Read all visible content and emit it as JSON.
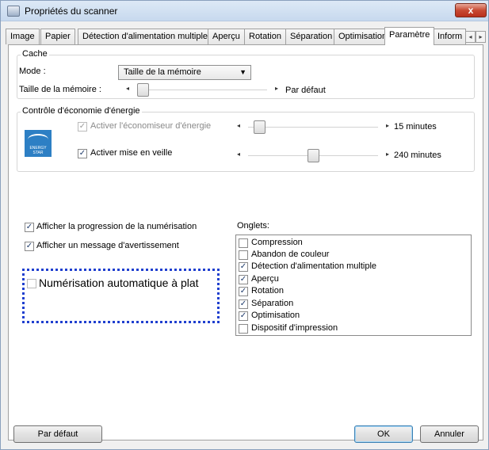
{
  "window": {
    "title": "Propriétés du scanner",
    "close_glyph": "x"
  },
  "tabs": [
    "Image",
    "Papier",
    "Détection d'alimentation multiple",
    "Aperçu",
    "Rotation",
    "Séparation",
    "Optimisation",
    "Paramètre",
    "Inform"
  ],
  "active_tab": "Paramètre",
  "tab_scroll": {
    "left": "◂",
    "right": "▸"
  },
  "cache": {
    "title": "Cache",
    "mode_label": "Mode :",
    "mode_value": "Taille de la mémoire",
    "size_label": "Taille de la mémoire :",
    "size_value": "Par défaut",
    "size_level": 0.0
  },
  "energy": {
    "title": "Contrôle d'économie d'énergie",
    "logo_text": "ENERGY STAR",
    "logo_script": "energy",
    "saver_label": "Activer l'économiseur d'énergie",
    "saver_checked": true,
    "saver_enabled": false,
    "saver_value": "15 minutes",
    "saver_level": 0.05,
    "sleep_label": "Activer mise en veille",
    "sleep_checked": true,
    "sleep_value": "240 minutes",
    "sleep_level": 0.5
  },
  "options": {
    "show_progress": "Afficher la progression de la numérisation",
    "show_warning": "Afficher un message d'avertissement",
    "auto_flatbed": "Numérisation automatique à plat"
  },
  "onglets": {
    "label": "Onglets:",
    "items": [
      {
        "label": "Compression",
        "checked": false
      },
      {
        "label": "Abandon de couleur",
        "checked": false
      },
      {
        "label": "Détection d'alimentation multiple",
        "checked": true
      },
      {
        "label": "Aperçu",
        "checked": true
      },
      {
        "label": "Rotation",
        "checked": true
      },
      {
        "label": "Séparation",
        "checked": true
      },
      {
        "label": "Optimisation",
        "checked": true
      },
      {
        "label": "Dispositif d'impression",
        "checked": false
      }
    ]
  },
  "buttons": {
    "default": "Par défaut",
    "ok": "OK",
    "cancel": "Annuler"
  },
  "icons": {
    "check": "✓",
    "dropdown": "▼",
    "arrow_left": "◂",
    "arrow_right": "▸"
  },
  "colors": {
    "highlight_border": "#1f3fcf",
    "close_red": "#c84a33",
    "energy_blue": "#2d7fc4"
  }
}
